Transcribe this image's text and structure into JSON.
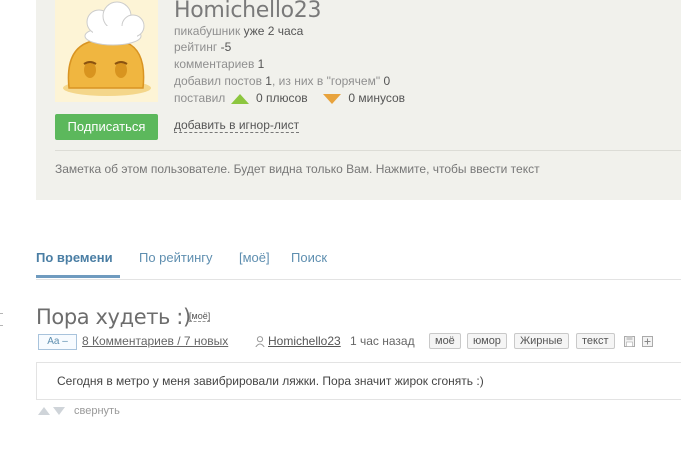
{
  "profile": {
    "username": "Homichello23",
    "pikabushnik_label": "пикабушник",
    "pikabushnik_value": "уже 2 часа",
    "rating_label": "рейтинг",
    "rating_value": "-5",
    "comments_label": "комментариев",
    "comments_value": "1",
    "posts_prefix": "добавил постов",
    "posts_value": "1",
    "posts_middle": ", из них в \"горячем\"",
    "hot_value": "0",
    "gave_label": "поставил",
    "pluses_value": "0 плюсов",
    "minuses_value": "0 минусов",
    "subscribe_label": "Подписаться",
    "ignore_label": "добавить в игнор-лист",
    "note_text": "Заметка об этом пользователе. Будет видна только Вам. Нажмите, чтобы ввести текст"
  },
  "tabs": [
    {
      "label": "По времени",
      "active": true
    },
    {
      "label": "По рейтингу",
      "active": false
    },
    {
      "label": "[моё]",
      "active": false
    },
    {
      "label": "Поиск",
      "active": false
    }
  ],
  "post": {
    "title": "Пора худеть :)",
    "my_label": "[моё]",
    "font_toggle": "Aa –",
    "comments_link": "8 Комментариев / 7 новых",
    "author": "Homichello23",
    "time": "1 час назад",
    "tags": [
      "моё",
      "юмор",
      "Жирные",
      "текст"
    ],
    "content": "Сегодня в метро у меня завибрировали ляжки. Пора значит жирок сгонять :)",
    "collapse_label": "свернуть"
  },
  "colors": {
    "accent_blue": "#4a7ea4",
    "subscribe_green": "#5cb85c",
    "plus_green": "#8cc63f",
    "minus_orange": "#e8a33d",
    "profile_bg": "#f1f1ec"
  },
  "icons": [
    "avatar-chef-bun",
    "thumb-up-triangle-icon",
    "thumb-down-triangle-icon",
    "user-icon",
    "save-icon",
    "plus-box-icon",
    "vote-arrows-icon"
  ]
}
